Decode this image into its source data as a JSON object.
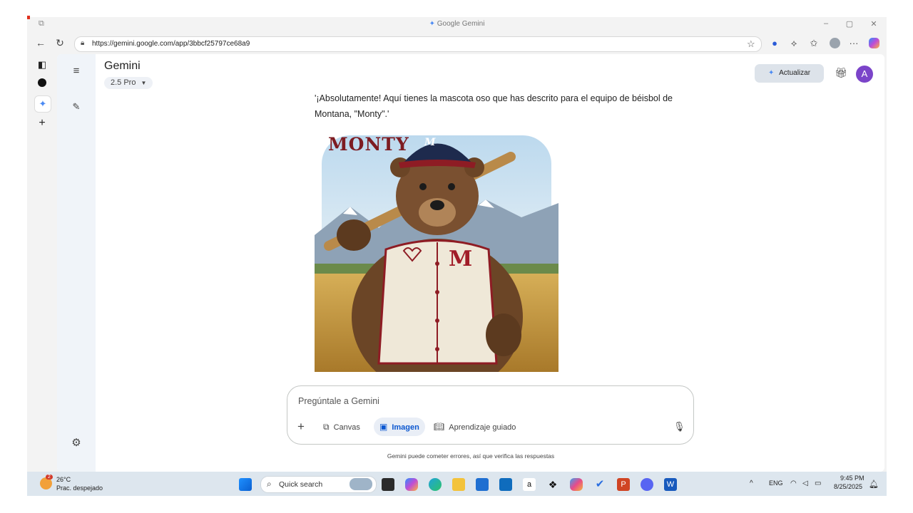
{
  "window": {
    "title": "Google Gemini"
  },
  "browser": {
    "url": "https://gemini.google.com/app/3bbcf25797ce68a9"
  },
  "app": {
    "name": "Gemini",
    "model": "2.5 Pro",
    "upgrade_label": "Actualizar",
    "avatar_letter": "A"
  },
  "conversation": {
    "response_text": "'¡Absolutamente! Aquí tienes la mascota oso que has descrito para el equipo de béisbol de Montana, \"Monty\".'",
    "image": {
      "overlay_text": "MONTY",
      "jersey_letter": "M",
      "cap_letter": "M"
    }
  },
  "prompt": {
    "placeholder": "Pregúntale a Gemini",
    "tools": [
      {
        "label": "Canvas",
        "icon": "canvas-icon",
        "active": false
      },
      {
        "label": "Imagen",
        "icon": "image-icon",
        "active": true
      },
      {
        "label": "Aprendizaje guiado",
        "icon": "book-icon",
        "active": false
      }
    ]
  },
  "disclaimer": "Gemini puede cometer errores, así que verifica las respuestas",
  "taskbar": {
    "weather_temp": "26°C",
    "weather_desc": "Prac. despejado",
    "weather_badge": "2",
    "search_label": "Quick search",
    "lang": "ENG",
    "time": "9:45 PM",
    "date": "8/25/2025"
  },
  "colors": {
    "accent": "#0b57d0",
    "avatar": "#7b44c9",
    "sidebar_bg": "#f0f4f9",
    "upgrade_bg": "#dde3ea"
  }
}
